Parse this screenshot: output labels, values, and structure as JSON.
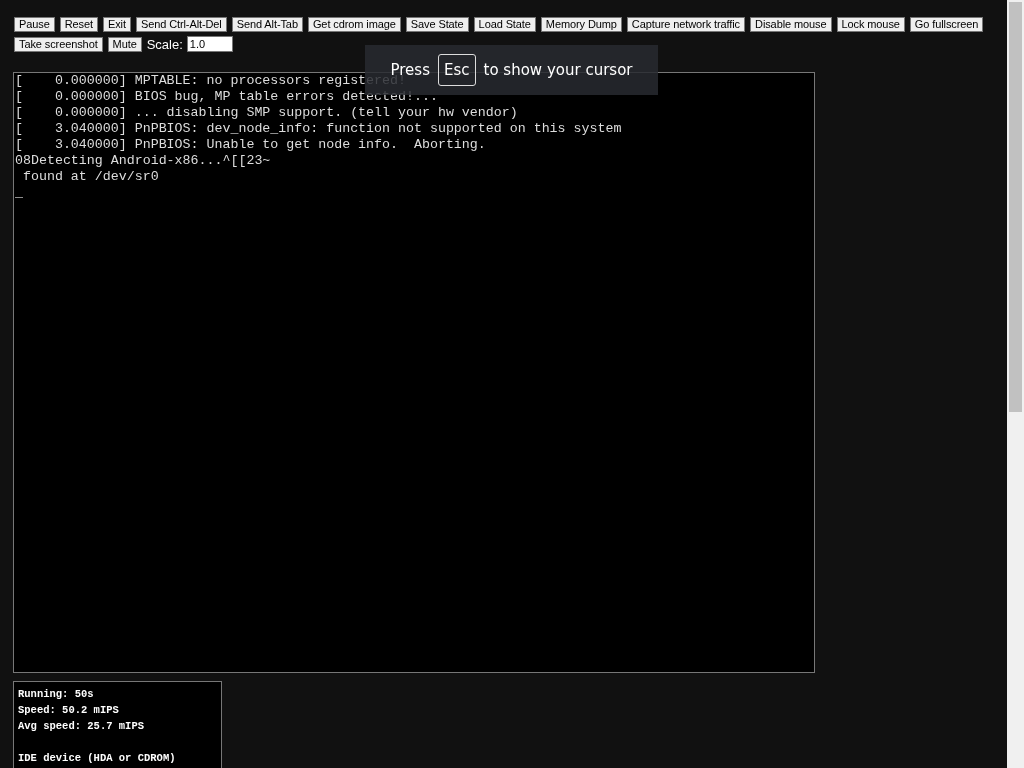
{
  "toolbar": {
    "buttons": [
      "Pause",
      "Reset",
      "Exit",
      "Send Ctrl-Alt-Del",
      "Send Alt-Tab",
      "Get cdrom image",
      "Save State",
      "Load State",
      "Memory Dump",
      "Capture network traffic",
      "Disable mouse",
      "Lock mouse",
      "Go fullscreen",
      "Take screenshot",
      "Mute"
    ],
    "scale": {
      "label": "Scale:",
      "value": "1.0"
    }
  },
  "overlay": {
    "before": "Press",
    "key": "Esc",
    "after": "to show your cursor"
  },
  "terminal": {
    "lines": [
      "[    0.000000] MPTABLE: no processors registered!",
      "[    0.000000] BIOS bug, MP table errors detected!...",
      "[    0.000000] ... disabling SMP support. (tell your hw vendor)",
      "[    3.040000] PnPBIOS: dev_node_info: function not supported on this system",
      "[    3.040000] PnPBIOS: Unable to get node info.  Aborting.",
      "08Detecting Android-x86...^[[23~",
      " found at /dev/sr0"
    ],
    "cursor": "_"
  },
  "stats": {
    "groups": [
      [
        "Running: 50s",
        "Speed: 50.2 mIPS",
        "Avg speed: 25.7 mIPS"
      ],
      [
        "IDE device (HDA or CDROM)"
      ]
    ]
  }
}
